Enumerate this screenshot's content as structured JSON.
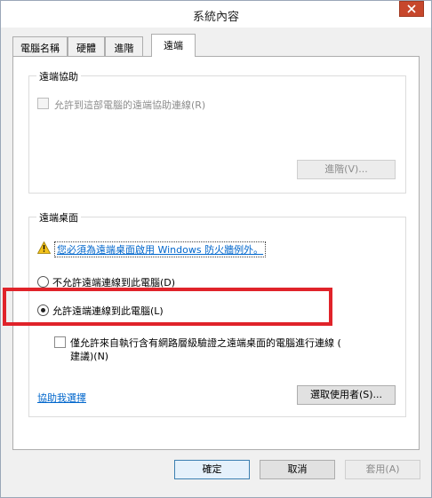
{
  "window": {
    "title": "系統內容",
    "close_icon": "close-icon"
  },
  "tabs": [
    {
      "label": "電腦名稱",
      "active": false
    },
    {
      "label": "硬體",
      "active": false
    },
    {
      "label": "進階",
      "active": false
    },
    {
      "label": "遠端",
      "active": true
    }
  ],
  "remote_assistance": {
    "legend": "遠端協助",
    "allow_checkbox_label": "允許到這部電腦的遠端協助連線(R)",
    "allow_checked": false,
    "advanced_button": "進階(V)..."
  },
  "remote_desktop": {
    "legend": "遠端桌面",
    "warning_link": "您必須為遠端桌面啟用 Windows 防火牆例外。",
    "option_deny": "不允許遠端連線到此電腦(D)",
    "option_allow": "允許遠端連線到此電腦(L)",
    "selected": "allow",
    "nla_checkbox_line1": "僅允許來自執行含有網路層級驗證之遠端桌面的電腦進行連線 (",
    "nla_checkbox_line2": "建議)(N)",
    "nla_checked": false,
    "help_link": "協助我選擇",
    "select_users_button": "選取使用者(S)..."
  },
  "footer": {
    "ok": "確定",
    "cancel": "取消",
    "apply": "套用(A)"
  },
  "colors": {
    "highlight": "#e0232a",
    "close": "#c7472c",
    "link": "#0066cc"
  }
}
